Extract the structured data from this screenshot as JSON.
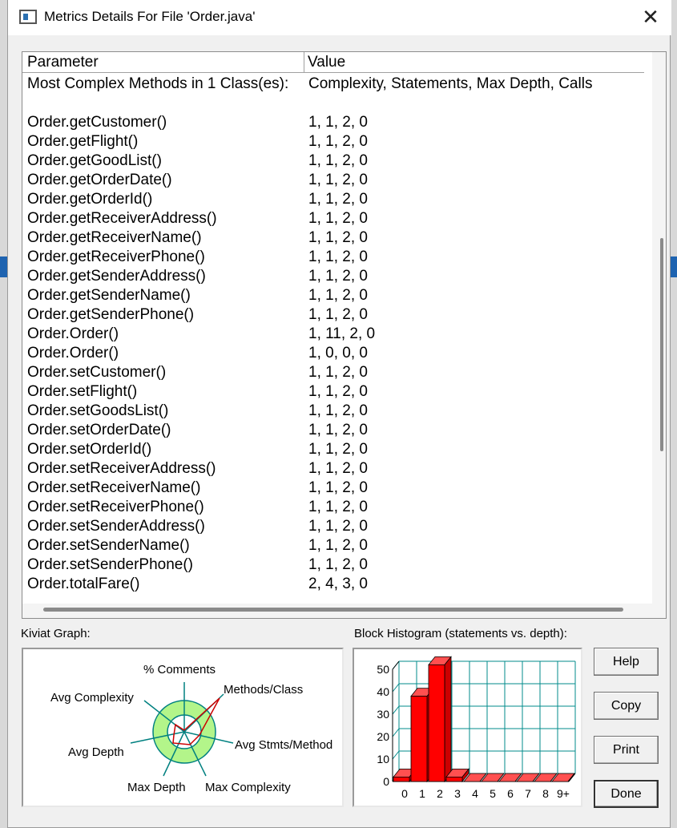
{
  "window": {
    "title": "Metrics Details For File 'Order.java'",
    "close_glyph": "✕"
  },
  "table": {
    "headers": {
      "parameter": "Parameter",
      "value": "Value"
    },
    "rows": [
      {
        "parameter": "Most Complex Methods in 1 Class(es):",
        "value": "Complexity, Statements, Max Depth, Calls"
      },
      {
        "parameter": "",
        "value": ""
      },
      {
        "parameter": "Order.getCustomer()",
        "value": "1, 1, 2, 0"
      },
      {
        "parameter": "Order.getFlight()",
        "value": "1, 1, 2, 0"
      },
      {
        "parameter": "Order.getGoodList()",
        "value": "1, 1, 2, 0"
      },
      {
        "parameter": "Order.getOrderDate()",
        "value": "1, 1, 2, 0"
      },
      {
        "parameter": "Order.getOrderId()",
        "value": "1, 1, 2, 0"
      },
      {
        "parameter": "Order.getReceiverAddress()",
        "value": "1, 1, 2, 0"
      },
      {
        "parameter": "Order.getReceiverName()",
        "value": "1, 1, 2, 0"
      },
      {
        "parameter": "Order.getReceiverPhone()",
        "value": "1, 1, 2, 0"
      },
      {
        "parameter": "Order.getSenderAddress()",
        "value": "1, 1, 2, 0"
      },
      {
        "parameter": "Order.getSenderName()",
        "value": "1, 1, 2, 0"
      },
      {
        "parameter": "Order.getSenderPhone()",
        "value": "1, 1, 2, 0"
      },
      {
        "parameter": "Order.Order()",
        "value": "1, 11, 2, 0"
      },
      {
        "parameter": "Order.Order()",
        "value": "1, 0, 0, 0"
      },
      {
        "parameter": "Order.setCustomer()",
        "value": "1, 1, 2, 0"
      },
      {
        "parameter": "Order.setFlight()",
        "value": "1, 1, 2, 0"
      },
      {
        "parameter": "Order.setGoodsList()",
        "value": "1, 1, 2, 0"
      },
      {
        "parameter": "Order.setOrderDate()",
        "value": "1, 1, 2, 0"
      },
      {
        "parameter": "Order.setOrderId()",
        "value": "1, 1, 2, 0"
      },
      {
        "parameter": "Order.setReceiverAddress()",
        "value": "1, 1, 2, 0"
      },
      {
        "parameter": "Order.setReceiverName()",
        "value": "1, 1, 2, 0"
      },
      {
        "parameter": "Order.setReceiverPhone()",
        "value": "1, 1, 2, 0"
      },
      {
        "parameter": "Order.setSenderAddress()",
        "value": "1, 1, 2, 0"
      },
      {
        "parameter": "Order.setSenderName()",
        "value": "1, 1, 2, 0"
      },
      {
        "parameter": "Order.setSenderPhone()",
        "value": "1, 1, 2, 0"
      },
      {
        "parameter": "Order.totalFare()",
        "value": "2, 4, 3, 0"
      }
    ]
  },
  "kiviat": {
    "label": "Kiviat Graph:",
    "axes": [
      "% Comments",
      "Methods/Class",
      "Avg Stmts/Method",
      "Max Complexity",
      "Max Depth",
      "Avg Depth",
      "Avg Complexity"
    ],
    "colors": {
      "ring": "#b3f58a",
      "spoke": "#008080",
      "inner": "#ffffff",
      "plot": "#cc0000"
    }
  },
  "histogram": {
    "label": "Block Histogram (statements vs. depth):",
    "bar_color": "#ff0000",
    "grid_color": "#008b8b"
  },
  "chart_data": {
    "type": "bar",
    "title": "Block Histogram (statements vs. depth):",
    "categories": [
      "0",
      "1",
      "2",
      "3",
      "4",
      "5",
      "6",
      "7",
      "8",
      "9+"
    ],
    "values": [
      2,
      38,
      52,
      2,
      0,
      0,
      0,
      0,
      0,
      0
    ],
    "y_ticks": [
      "0",
      "10",
      "20",
      "30",
      "40",
      "50"
    ],
    "ylim": [
      0,
      50
    ],
    "grid": true
  },
  "buttons": {
    "help": "Help",
    "copy": "Copy",
    "print": "Print",
    "done": "Done"
  }
}
